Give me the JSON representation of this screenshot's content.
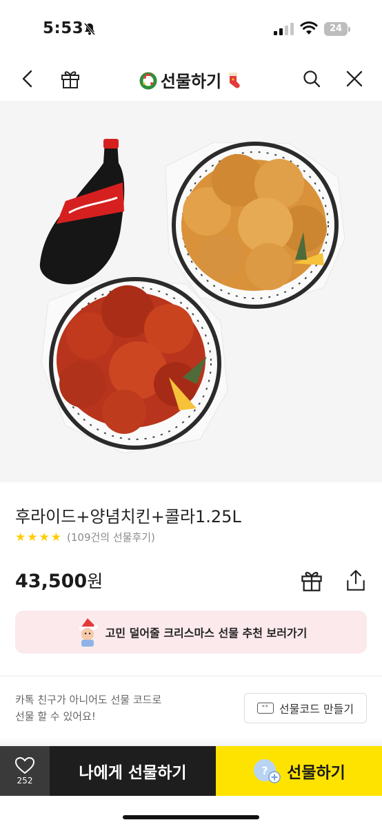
{
  "status_bar": {
    "time": "5:53",
    "battery": "24",
    "icons": [
      "bell-slash-icon",
      "signal-icon",
      "wifi-icon",
      "battery-icon"
    ]
  },
  "header": {
    "title": "선물하기",
    "left_icons": [
      "back-chevron-icon",
      "gift-icon"
    ],
    "right_icons": [
      "search-icon",
      "close-icon"
    ],
    "title_decorations": [
      "wreath-icon",
      "stocking-icon"
    ]
  },
  "product": {
    "name": "후라이드+양념치킨+콜라1.25L",
    "rating_stars": 4,
    "review_text": "(109건의 선물후기)",
    "price": "43,500",
    "currency": "원"
  },
  "promo": {
    "text": "고민 덜어줄 크리스마스 선물 추천 보러가기",
    "icon": "santa-character-icon"
  },
  "gift_code": {
    "note_line1": "카톡 친구가 아니어도 선물 코드로",
    "note_line2": "선물 할 수 있어요!",
    "button_label": "선물코드 만들기",
    "icon_text": "**"
  },
  "bottom_bar": {
    "like_count": "252",
    "self_gift_label": "나에게 선물하기",
    "gift_label": "선물하기"
  },
  "colors": {
    "accent_yellow": "#ffe300",
    "star": "#ffcc00",
    "promo_bg": "#fbe9ec",
    "dark_button": "#1e1e1e"
  }
}
